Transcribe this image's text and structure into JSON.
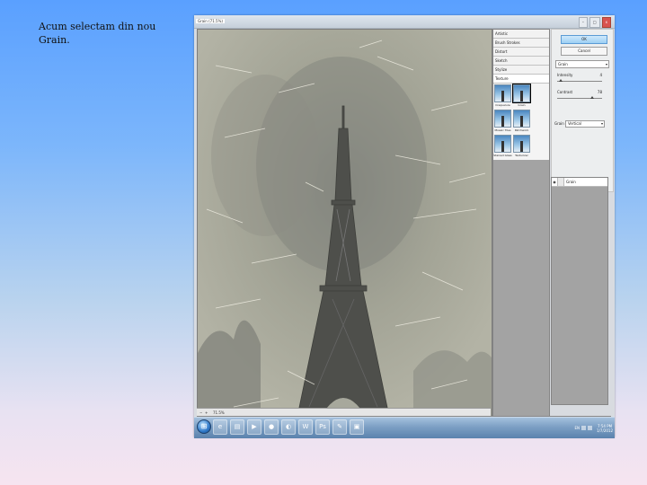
{
  "caption": "Acum selectam din nou Grain.",
  "window": {
    "doc_title": "Grain (71.5%)",
    "buttons": [
      "OK",
      "Cancel"
    ],
    "close_label": "x"
  },
  "effects": {
    "categories": [
      "Artistic",
      "Brush Strokes",
      "Distort",
      "Sketch",
      "Stylize",
      "Texture"
    ],
    "open_category": "Texture",
    "thumbnails": [
      "Craquelure",
      "Grain",
      "Mosaic Tiles",
      "Patchwork",
      "Stained Glass",
      "Texturizer"
    ],
    "selected": "Grain"
  },
  "settings": {
    "filter_select": "Grain",
    "intensity_label": "Intensity",
    "intensity_value": "4",
    "intensity_level": 0.08,
    "contrast_label": "Contrast",
    "contrast_value": "78",
    "contrast_level": 0.78,
    "grain_type_label": "Grain Type",
    "grain_type_value": "Vertical"
  },
  "layers": {
    "row_label": "Grain"
  },
  "statusbar": {
    "zoom": "71.5%"
  },
  "taskbar": {
    "apps": [
      "IE",
      "Explorer",
      "Media",
      "Chrome",
      "Firefox",
      "Word",
      "Photoshop",
      "Paint",
      "Pictures"
    ],
    "time": "7:54 PM",
    "date": "1/7/2012",
    "lang": "EN"
  },
  "colors": {
    "accent": "#9dcff4",
    "taskbar": "#7c9fc4"
  }
}
